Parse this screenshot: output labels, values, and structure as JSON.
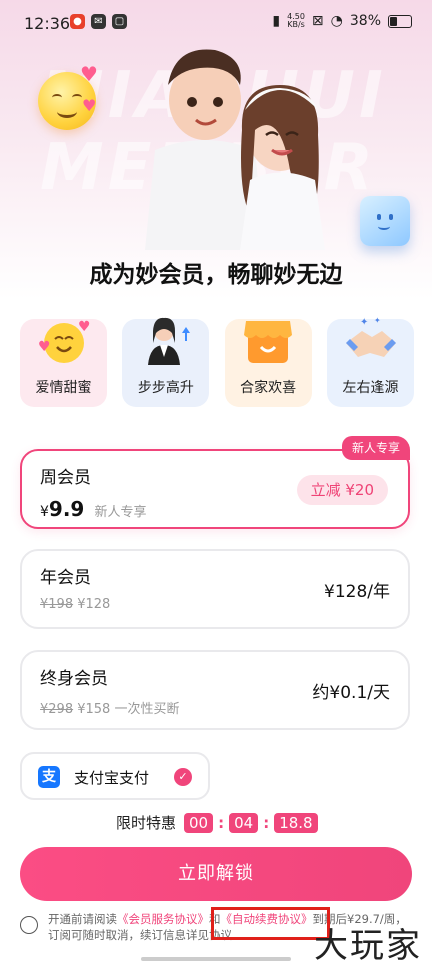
{
  "status_bar": {
    "time": "12:36",
    "net_speed_value": "4.50",
    "net_speed_unit": "KB/s",
    "battery": "38%"
  },
  "hero": {
    "watermark": "MIAOHUI MEMBER",
    "headline": "成为妙会员，畅聊妙无边"
  },
  "features": [
    {
      "label": "爱情甜蜜",
      "bg": "#fde9ef"
    },
    {
      "label": "步步高升",
      "bg": "#eaf0fb"
    },
    {
      "label": "合家欢喜",
      "bg": "#fff2e3"
    },
    {
      "label": "左右逢源",
      "bg": "#e9f1fd"
    }
  ],
  "plans": {
    "week": {
      "name": "周会员",
      "price_currency": "¥",
      "price": "9.9",
      "sub": "新人专享",
      "discount": "立减 ¥20",
      "tag": "新人专享"
    },
    "year": {
      "name": "年会员",
      "original": "¥198",
      "current": "¥128",
      "right": "¥128/年"
    },
    "lifetime": {
      "name": "终身会员",
      "original": "¥298",
      "current": "¥158",
      "note": "一次性买断",
      "right": "约¥0.1/天"
    }
  },
  "payment": {
    "logo": "支",
    "label": "支付宝支付",
    "check": "✓"
  },
  "countdown": {
    "label": "限时特惠",
    "hh": "00",
    "sep": ":",
    "mm": "04",
    "ss": "18.8"
  },
  "cta": {
    "label": "立即解锁"
  },
  "agreement": {
    "prefix": "开通前请阅读",
    "link1": "《会员服务协议》",
    "mid": "和",
    "link2": "《自动续费协议》",
    "suffix": "到期后¥29.7/周，订阅可随时取消，续订信息详见协议"
  },
  "brand_watermark": "大玩家",
  "colors": {
    "accent": "#f0457b",
    "highlight": "#e0201a"
  }
}
